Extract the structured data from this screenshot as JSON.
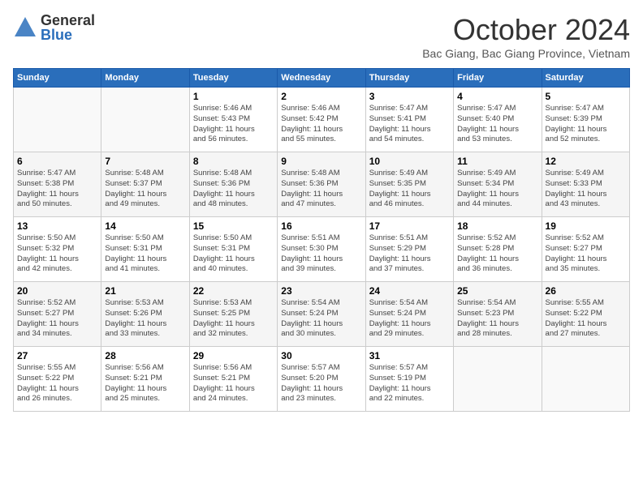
{
  "logo": {
    "general": "General",
    "blue": "Blue"
  },
  "title": "October 2024",
  "location": "Bac Giang, Bac Giang Province, Vietnam",
  "days_of_week": [
    "Sunday",
    "Monday",
    "Tuesday",
    "Wednesday",
    "Thursday",
    "Friday",
    "Saturday"
  ],
  "weeks": [
    [
      {
        "day": "",
        "info": ""
      },
      {
        "day": "",
        "info": ""
      },
      {
        "day": "1",
        "info": "Sunrise: 5:46 AM\nSunset: 5:43 PM\nDaylight: 11 hours\nand 56 minutes."
      },
      {
        "day": "2",
        "info": "Sunrise: 5:46 AM\nSunset: 5:42 PM\nDaylight: 11 hours\nand 55 minutes."
      },
      {
        "day": "3",
        "info": "Sunrise: 5:47 AM\nSunset: 5:41 PM\nDaylight: 11 hours\nand 54 minutes."
      },
      {
        "day": "4",
        "info": "Sunrise: 5:47 AM\nSunset: 5:40 PM\nDaylight: 11 hours\nand 53 minutes."
      },
      {
        "day": "5",
        "info": "Sunrise: 5:47 AM\nSunset: 5:39 PM\nDaylight: 11 hours\nand 52 minutes."
      }
    ],
    [
      {
        "day": "6",
        "info": "Sunrise: 5:47 AM\nSunset: 5:38 PM\nDaylight: 11 hours\nand 50 minutes."
      },
      {
        "day": "7",
        "info": "Sunrise: 5:48 AM\nSunset: 5:37 PM\nDaylight: 11 hours\nand 49 minutes."
      },
      {
        "day": "8",
        "info": "Sunrise: 5:48 AM\nSunset: 5:36 PM\nDaylight: 11 hours\nand 48 minutes."
      },
      {
        "day": "9",
        "info": "Sunrise: 5:48 AM\nSunset: 5:36 PM\nDaylight: 11 hours\nand 47 minutes."
      },
      {
        "day": "10",
        "info": "Sunrise: 5:49 AM\nSunset: 5:35 PM\nDaylight: 11 hours\nand 46 minutes."
      },
      {
        "day": "11",
        "info": "Sunrise: 5:49 AM\nSunset: 5:34 PM\nDaylight: 11 hours\nand 44 minutes."
      },
      {
        "day": "12",
        "info": "Sunrise: 5:49 AM\nSunset: 5:33 PM\nDaylight: 11 hours\nand 43 minutes."
      }
    ],
    [
      {
        "day": "13",
        "info": "Sunrise: 5:50 AM\nSunset: 5:32 PM\nDaylight: 11 hours\nand 42 minutes."
      },
      {
        "day": "14",
        "info": "Sunrise: 5:50 AM\nSunset: 5:31 PM\nDaylight: 11 hours\nand 41 minutes."
      },
      {
        "day": "15",
        "info": "Sunrise: 5:50 AM\nSunset: 5:31 PM\nDaylight: 11 hours\nand 40 minutes."
      },
      {
        "day": "16",
        "info": "Sunrise: 5:51 AM\nSunset: 5:30 PM\nDaylight: 11 hours\nand 39 minutes."
      },
      {
        "day": "17",
        "info": "Sunrise: 5:51 AM\nSunset: 5:29 PM\nDaylight: 11 hours\nand 37 minutes."
      },
      {
        "day": "18",
        "info": "Sunrise: 5:52 AM\nSunset: 5:28 PM\nDaylight: 11 hours\nand 36 minutes."
      },
      {
        "day": "19",
        "info": "Sunrise: 5:52 AM\nSunset: 5:27 PM\nDaylight: 11 hours\nand 35 minutes."
      }
    ],
    [
      {
        "day": "20",
        "info": "Sunrise: 5:52 AM\nSunset: 5:27 PM\nDaylight: 11 hours\nand 34 minutes."
      },
      {
        "day": "21",
        "info": "Sunrise: 5:53 AM\nSunset: 5:26 PM\nDaylight: 11 hours\nand 33 minutes."
      },
      {
        "day": "22",
        "info": "Sunrise: 5:53 AM\nSunset: 5:25 PM\nDaylight: 11 hours\nand 32 minutes."
      },
      {
        "day": "23",
        "info": "Sunrise: 5:54 AM\nSunset: 5:24 PM\nDaylight: 11 hours\nand 30 minutes."
      },
      {
        "day": "24",
        "info": "Sunrise: 5:54 AM\nSunset: 5:24 PM\nDaylight: 11 hours\nand 29 minutes."
      },
      {
        "day": "25",
        "info": "Sunrise: 5:54 AM\nSunset: 5:23 PM\nDaylight: 11 hours\nand 28 minutes."
      },
      {
        "day": "26",
        "info": "Sunrise: 5:55 AM\nSunset: 5:22 PM\nDaylight: 11 hours\nand 27 minutes."
      }
    ],
    [
      {
        "day": "27",
        "info": "Sunrise: 5:55 AM\nSunset: 5:22 PM\nDaylight: 11 hours\nand 26 minutes."
      },
      {
        "day": "28",
        "info": "Sunrise: 5:56 AM\nSunset: 5:21 PM\nDaylight: 11 hours\nand 25 minutes."
      },
      {
        "day": "29",
        "info": "Sunrise: 5:56 AM\nSunset: 5:21 PM\nDaylight: 11 hours\nand 24 minutes."
      },
      {
        "day": "30",
        "info": "Sunrise: 5:57 AM\nSunset: 5:20 PM\nDaylight: 11 hours\nand 23 minutes."
      },
      {
        "day": "31",
        "info": "Sunrise: 5:57 AM\nSunset: 5:19 PM\nDaylight: 11 hours\nand 22 minutes."
      },
      {
        "day": "",
        "info": ""
      },
      {
        "day": "",
        "info": ""
      }
    ]
  ]
}
